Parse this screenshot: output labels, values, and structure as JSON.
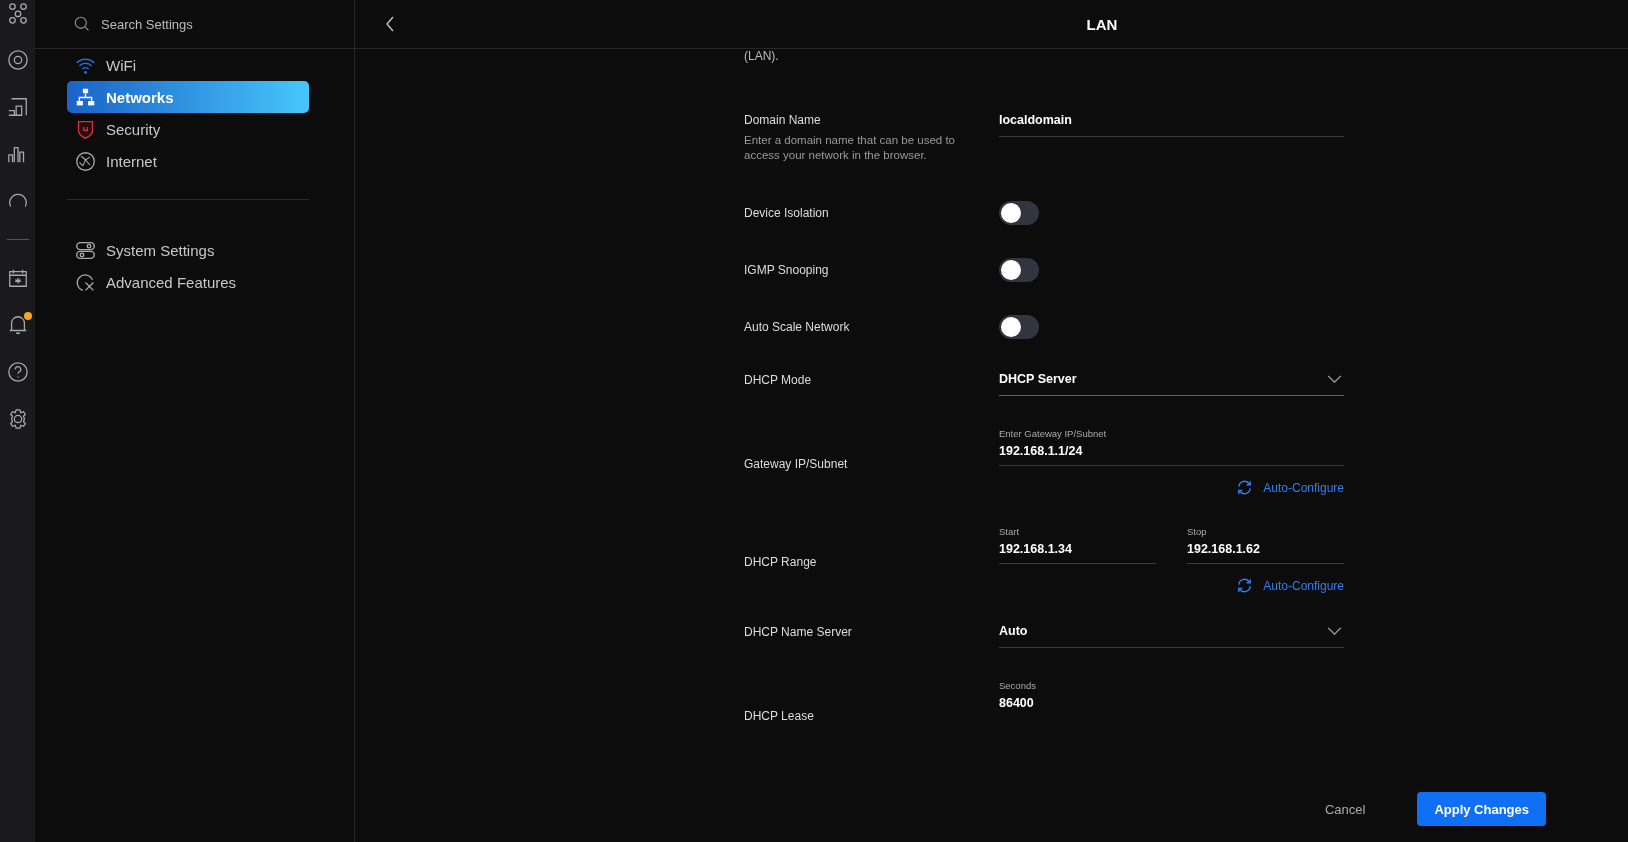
{
  "rail": {
    "unread_notifications": true
  },
  "search": {
    "placeholder": "Search Settings"
  },
  "sidebar": {
    "groups": [
      [
        {
          "label": "WiFi",
          "selected": false
        },
        {
          "label": "Networks",
          "selected": true
        },
        {
          "label": "Security",
          "selected": false
        },
        {
          "label": "Internet",
          "selected": false
        }
      ],
      [
        {
          "label": "System Settings",
          "selected": false
        },
        {
          "label": "Advanced Features",
          "selected": false
        }
      ]
    ]
  },
  "header": {
    "title": "LAN"
  },
  "form": {
    "intro_tail": "(LAN).",
    "rows": [
      {
        "kind": "text",
        "label": "Domain Name",
        "help": "Enter a domain name that can be used to access your network in the browser.",
        "value": "localdomain"
      },
      {
        "kind": "toggle",
        "label": "Device Isolation",
        "on": false
      },
      {
        "kind": "toggle",
        "label": "IGMP Snooping",
        "on": false
      },
      {
        "kind": "toggle",
        "label": "Auto Scale Network",
        "on": false
      },
      {
        "kind": "select",
        "label": "DHCP Mode",
        "value": "DHCP Server",
        "focused": true
      },
      {
        "kind": "input",
        "label": "Gateway IP/Subnet",
        "fields": [
          {
            "caption": "Enter Gateway IP/Subnet",
            "value": "192.168.1.1/24"
          }
        ],
        "action": "Auto-Configure"
      },
      {
        "kind": "input",
        "label": "DHCP Range",
        "fields": [
          {
            "caption": "Start",
            "value": "192.168.1.34"
          },
          {
            "caption": "Stop",
            "value": "192.168.1.62"
          }
        ],
        "action": "Auto-Configure"
      },
      {
        "kind": "select",
        "label": "DHCP Name Server",
        "value": "Auto",
        "focused": false
      },
      {
        "kind": "lease",
        "label": "DHCP Lease",
        "fields": [
          {
            "caption": "Seconds",
            "value": "86400"
          }
        ]
      }
    ]
  },
  "footer": {
    "buttons": [
      {
        "label": "Cancel",
        "kind": "secondary"
      },
      {
        "label": "Apply Changes",
        "kind": "primary"
      }
    ]
  }
}
